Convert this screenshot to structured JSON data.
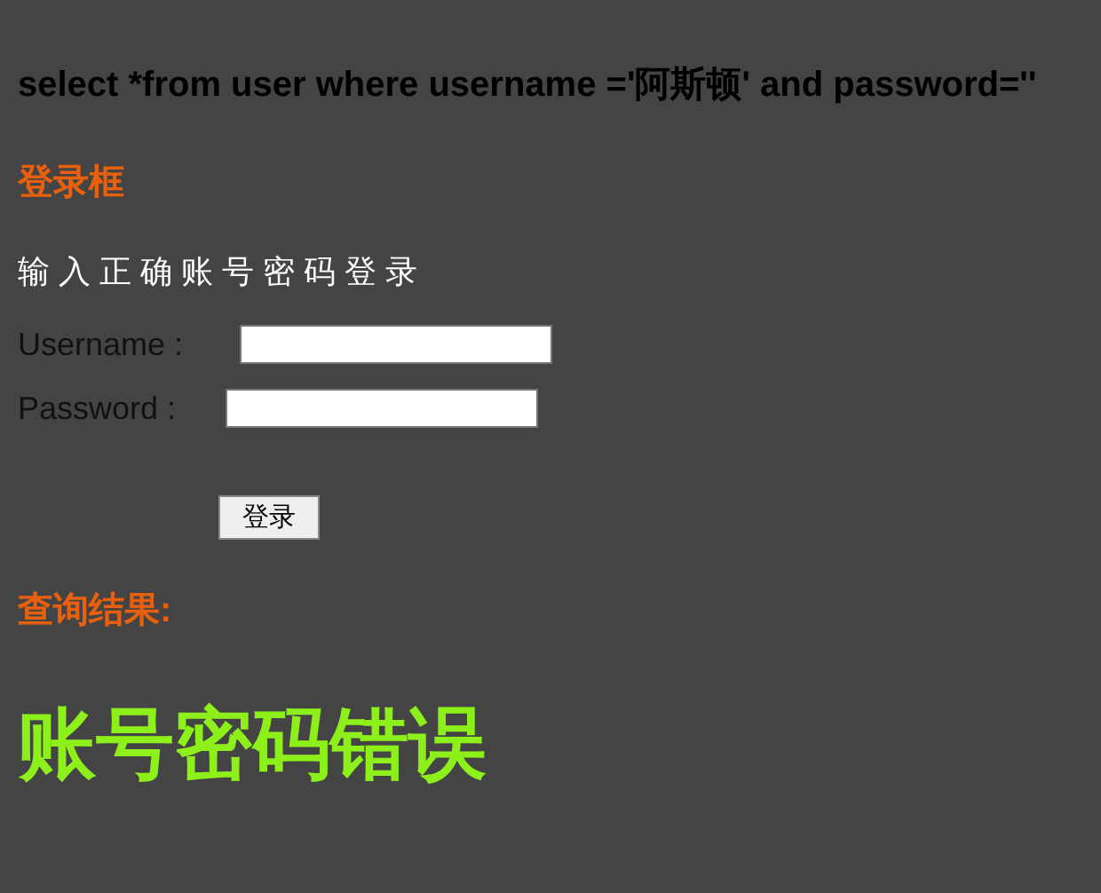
{
  "query": {
    "sql": "select *from user where username ='阿斯顿' and password=''"
  },
  "login": {
    "heading": "登录框",
    "instruction": "输 入 正 确 账 号 密 码 登 录",
    "fields": [
      {
        "label": "Username :"
      },
      {
        "label": "Password :"
      }
    ],
    "button": "登录"
  },
  "result": {
    "heading": "查询结果:",
    "message": "账号密码错误"
  }
}
